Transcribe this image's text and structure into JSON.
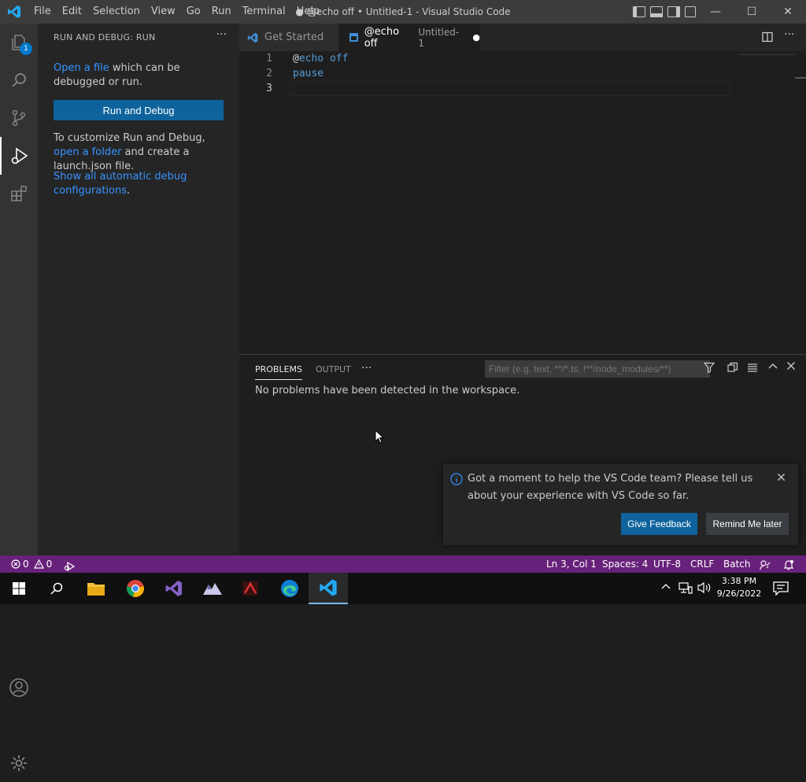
{
  "window": {
    "title": "● @echo off • Untitled-1 - Visual Studio Code",
    "menu": [
      "File",
      "Edit",
      "Selection",
      "View",
      "Go",
      "Run",
      "Terminal",
      "Help"
    ]
  },
  "activity": {
    "explorer_badge": "1"
  },
  "sidebar": {
    "title": "RUN AND DEBUG: RUN",
    "open_file_link": "Open a file",
    "open_file_rest": " which can be debugged or run.",
    "run_button": "Run and Debug",
    "customize_text": "To customize Run and Debug, ",
    "open_folder_link": "open a folder",
    "customize_rest": " and create a launch.json file.",
    "show_configs_link": "Show all automatic debug configurations",
    "show_configs_rest": "."
  },
  "tabs": [
    {
      "label": "Get Started"
    },
    {
      "label": "@echo off",
      "description": "Untitled-1",
      "modified": "●"
    }
  ],
  "editor": {
    "lines": [
      {
        "number": "1",
        "at": "@",
        "text": "echo off"
      },
      {
        "number": "2",
        "text": "pause"
      },
      {
        "number": "3",
        "text": ""
      }
    ]
  },
  "panel": {
    "tabs": [
      "PROBLEMS",
      "OUTPUT"
    ],
    "more": "···",
    "filter_placeholder": "Filter (e.g. text, **/*.ts, !**/node_modules/**)",
    "message": "No problems have been detected in the workspace."
  },
  "notification": {
    "message": "Got a moment to help the VS Code team? Please tell us about your experience with VS Code so far.",
    "primary_button": "Give Feedback",
    "secondary_button": "Remind Me later"
  },
  "statusbar": {
    "errors": "0",
    "warnings": "0",
    "position": "Ln 3, Col 1",
    "spaces": "Spaces: 4",
    "encoding": "UTF-8",
    "eol": "CRLF",
    "language": "Batch"
  },
  "taskbar": {
    "time": "3:38 PM",
    "date": "9/26/2022"
  },
  "colors": {
    "statusbar": "#68217a",
    "accent": "#0e639c",
    "link": "#3794ff"
  }
}
